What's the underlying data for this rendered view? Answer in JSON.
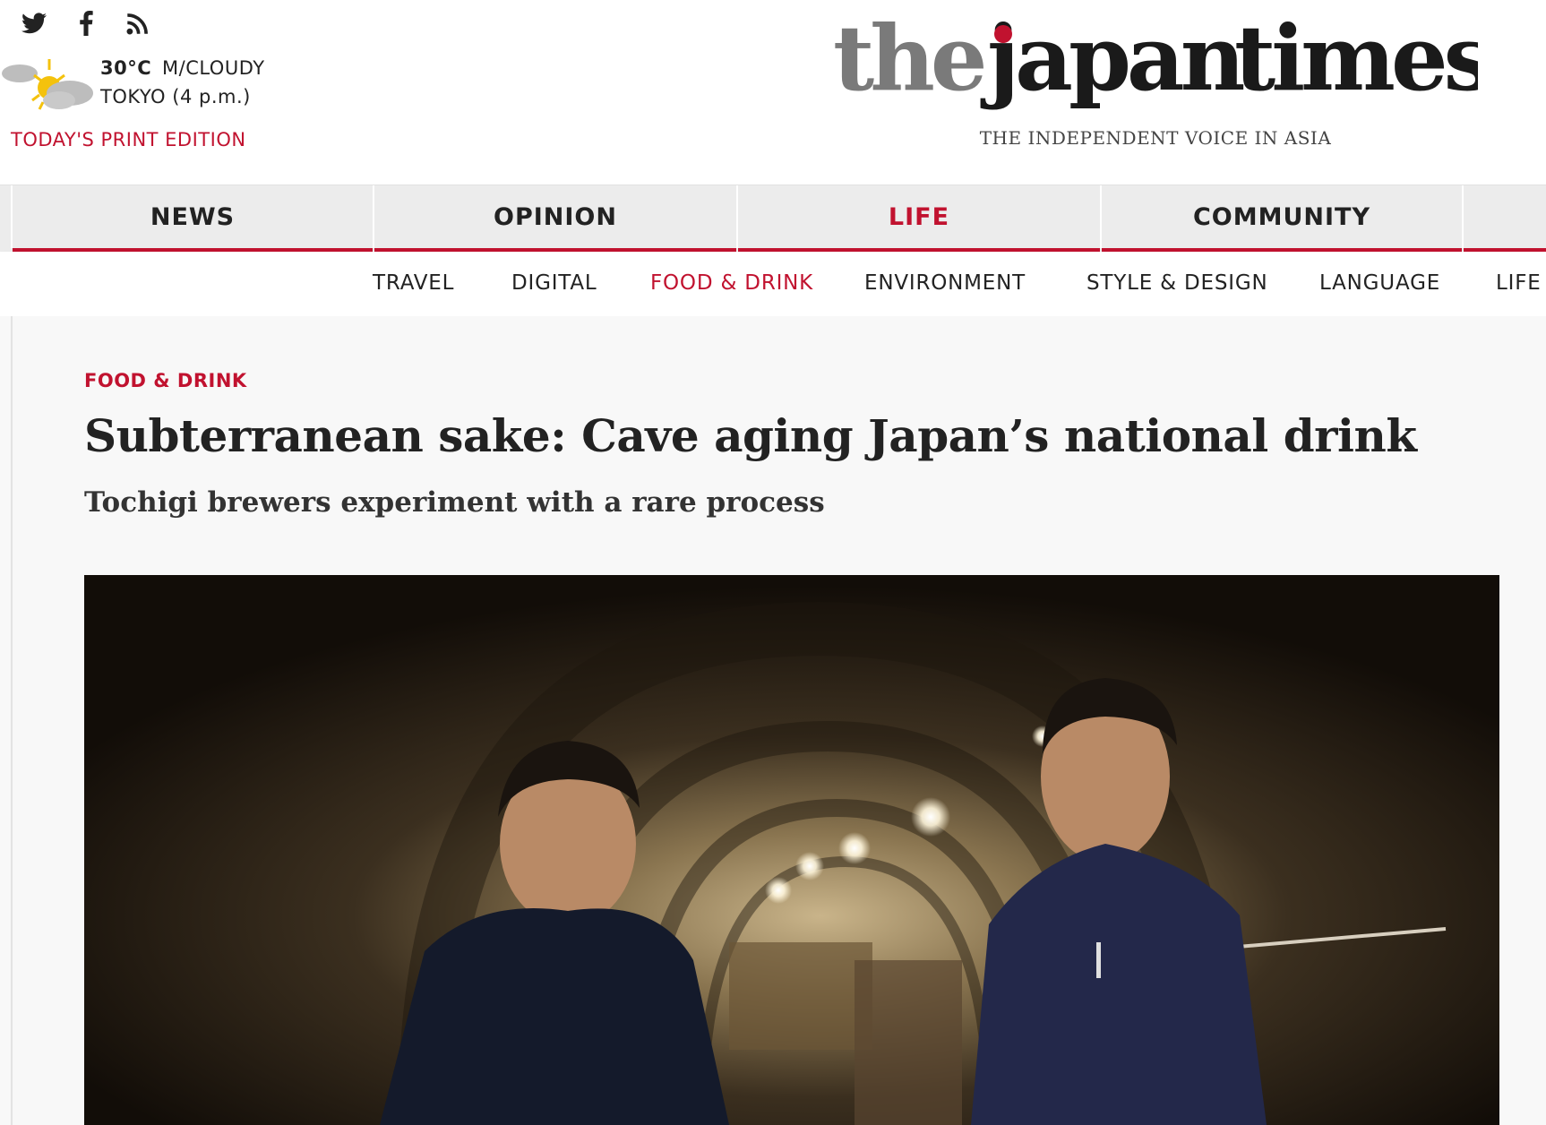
{
  "header": {
    "social": [
      {
        "name": "twitter-icon"
      },
      {
        "name": "facebook-icon"
      },
      {
        "name": "rss-icon"
      }
    ],
    "weather": {
      "temp": "30°C",
      "condition": "M/CLOUDY",
      "location": "TOKYO (4 p.m.)",
      "icon": "partly-cloudy-icon"
    },
    "print_edition": "TODAY'S PRINT EDITION",
    "logo": {
      "the": "the",
      "japan": "japan",
      "times": "times"
    },
    "tagline": "THE INDEPENDENT VOICE IN ASIA"
  },
  "main_nav": [
    {
      "label": "NEWS",
      "active": false
    },
    {
      "label": "OPINION",
      "active": false
    },
    {
      "label": "LIFE",
      "active": true
    },
    {
      "label": "COMMUNITY",
      "active": false
    }
  ],
  "sub_nav": [
    {
      "label": "TRAVEL",
      "active": false
    },
    {
      "label": "DIGITAL",
      "active": false
    },
    {
      "label": "FOOD & DRINK",
      "active": true
    },
    {
      "label": "ENVIRONMENT",
      "active": false
    },
    {
      "label": "STYLE & DESIGN",
      "active": false
    },
    {
      "label": "LANGUAGE",
      "active": false
    },
    {
      "label": "LIFE",
      "active": false
    }
  ],
  "article": {
    "kicker": "FOOD & DRINK",
    "headline": "Subterranean sake: Cave aging Japan’s national drink",
    "subhead": "Tochigi brewers experiment with a rare process"
  },
  "colors": {
    "accent": "#c1122f",
    "nav_bg": "#ececec",
    "article_bg": "#f8f8f8",
    "logo_gray": "#7a7a7a",
    "logo_dark": "#1a1a1a"
  }
}
